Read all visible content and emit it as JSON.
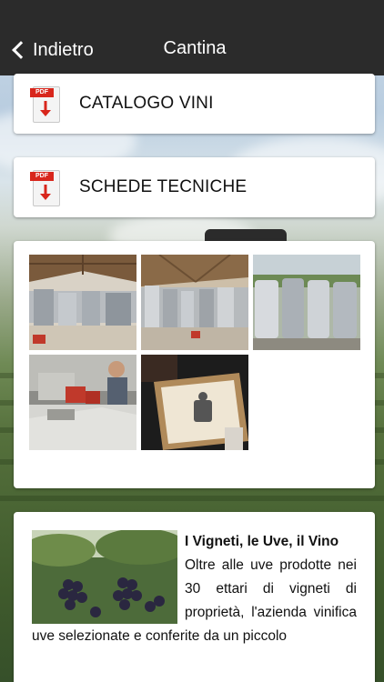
{
  "header": {
    "back_label": "Indietro",
    "title": "Cantina"
  },
  "documents": [
    {
      "label": "CATALOGO VINI",
      "icon": "pdf-download-icon"
    },
    {
      "label": "SCHEDE TECNICHE",
      "icon": "pdf-download-icon"
    }
  ],
  "pdf_tag": "PDF",
  "gallery": {
    "photos": [
      "winery-cellar-photo",
      "winery-tanks-photo",
      "steel-vats-photo",
      "bottling-line-photo",
      "wine-box-photo"
    ]
  },
  "article": {
    "title": "I Vigneti, le Uve, il Vino",
    "body": "Oltre alle uve prodotte nei 30 ettari di vigneti di proprietà, l'azienda vinifica uve selezionate e conferite da un piccolo"
  },
  "colors": {
    "topbar": "#2b2b2b",
    "pdf_red": "#d8261c",
    "card": "#ffffff"
  }
}
